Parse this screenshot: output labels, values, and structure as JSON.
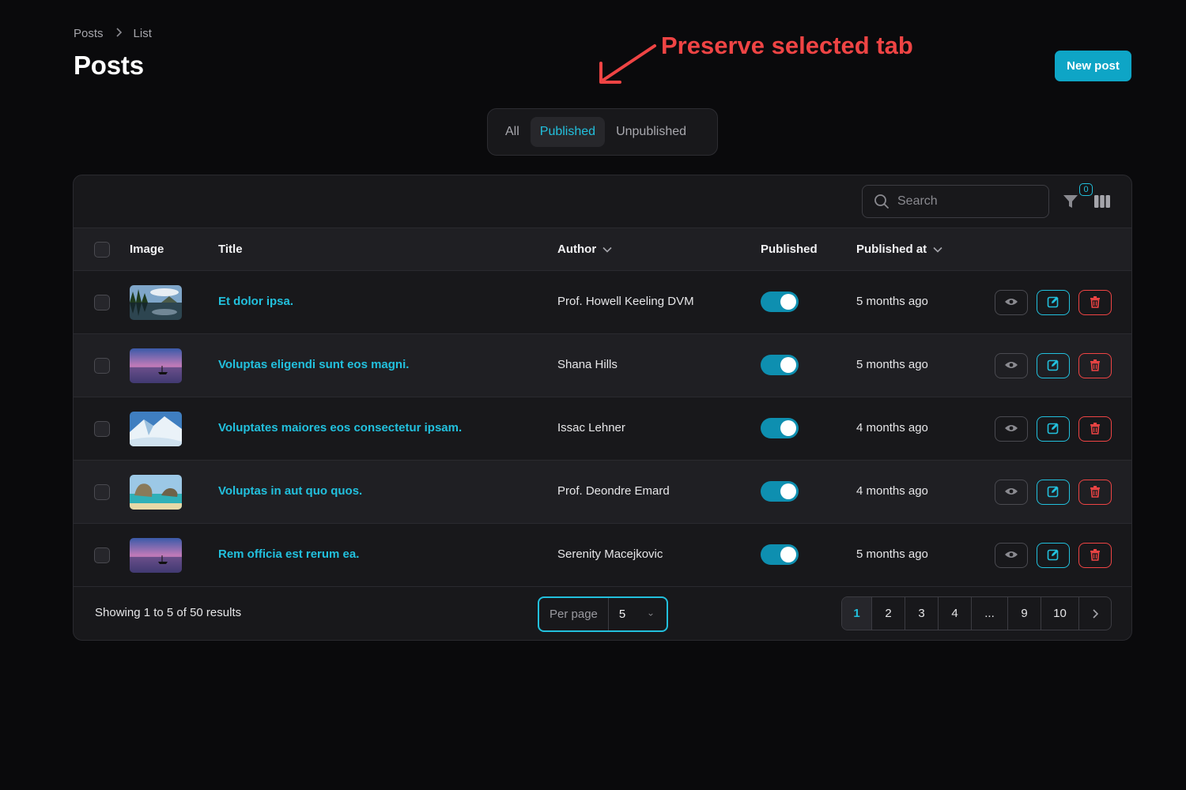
{
  "breadcrumb": {
    "root": "Posts",
    "current": "List"
  },
  "page_title": "Posts",
  "new_post_label": "New post",
  "annotation": "Preserve selected tab",
  "tabs": [
    {
      "label": "All",
      "active": false
    },
    {
      "label": "Published",
      "active": true
    },
    {
      "label": "Unpublished",
      "active": false
    }
  ],
  "toolbar": {
    "search_placeholder": "Search",
    "filter_count": "0"
  },
  "columns": {
    "image": "Image",
    "title": "Title",
    "author": "Author",
    "published": "Published",
    "published_at": "Published at"
  },
  "rows": [
    {
      "title": "Et dolor ipsa.",
      "author": "Prof. Howell Keeling DVM",
      "published": true,
      "published_at": "5 months ago",
      "thumb": "forest-lake"
    },
    {
      "title": "Voluptas eligendi sunt eos magni.",
      "author": "Shana Hills",
      "published": true,
      "published_at": "5 months ago",
      "thumb": "sunset-boat"
    },
    {
      "title": "Voluptates maiores eos consectetur ipsam.",
      "author": "Issac Lehner",
      "published": true,
      "published_at": "4 months ago",
      "thumb": "snow-mountain"
    },
    {
      "title": "Voluptas in aut quo quos.",
      "author": "Prof. Deondre Emard",
      "published": true,
      "published_at": "4 months ago",
      "thumb": "beach-rocks"
    },
    {
      "title": "Rem officia est rerum ea.",
      "author": "Serenity Macejkovic",
      "published": true,
      "published_at": "5 months ago",
      "thumb": "sunset-boat"
    }
  ],
  "footer": {
    "showing": "Showing 1 to 5 of 50 results",
    "per_page_label": "Per page",
    "per_page_value": "5",
    "pages": [
      "1",
      "2",
      "3",
      "4",
      "...",
      "9",
      "10"
    ],
    "current_page": "1"
  },
  "colors": {
    "accent": "#22c0dd",
    "danger": "#ef4444",
    "primary_button": "#0ea5c6",
    "annotation": "#ef4444"
  }
}
